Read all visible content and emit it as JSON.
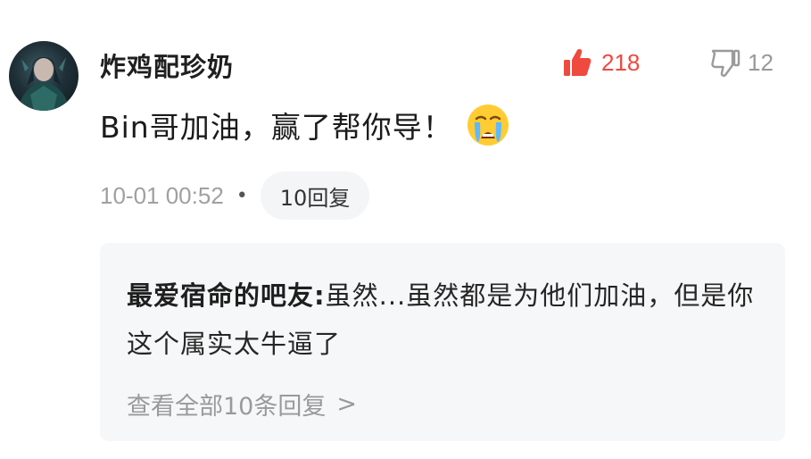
{
  "comment": {
    "username": "炸鸡配珍奶",
    "text": "Bin哥加油，赢了帮你导！",
    "emoji": "crying-face-emoji",
    "timestamp": "10-01 00:52",
    "separator": "•",
    "reply_button_label": "10回复",
    "likes": "218",
    "dislikes": "12",
    "like_color": "#f0493e",
    "dislike_color": "#999999"
  },
  "replies": {
    "items": [
      {
        "author": "最爱宿命的吧友",
        "colon": ":",
        "text": "虽然...虽然都是为他们加油，但是你这个属实太牛逼了"
      }
    ],
    "view_all_label": "查看全部10条回复",
    "view_all_chevron": ">"
  }
}
